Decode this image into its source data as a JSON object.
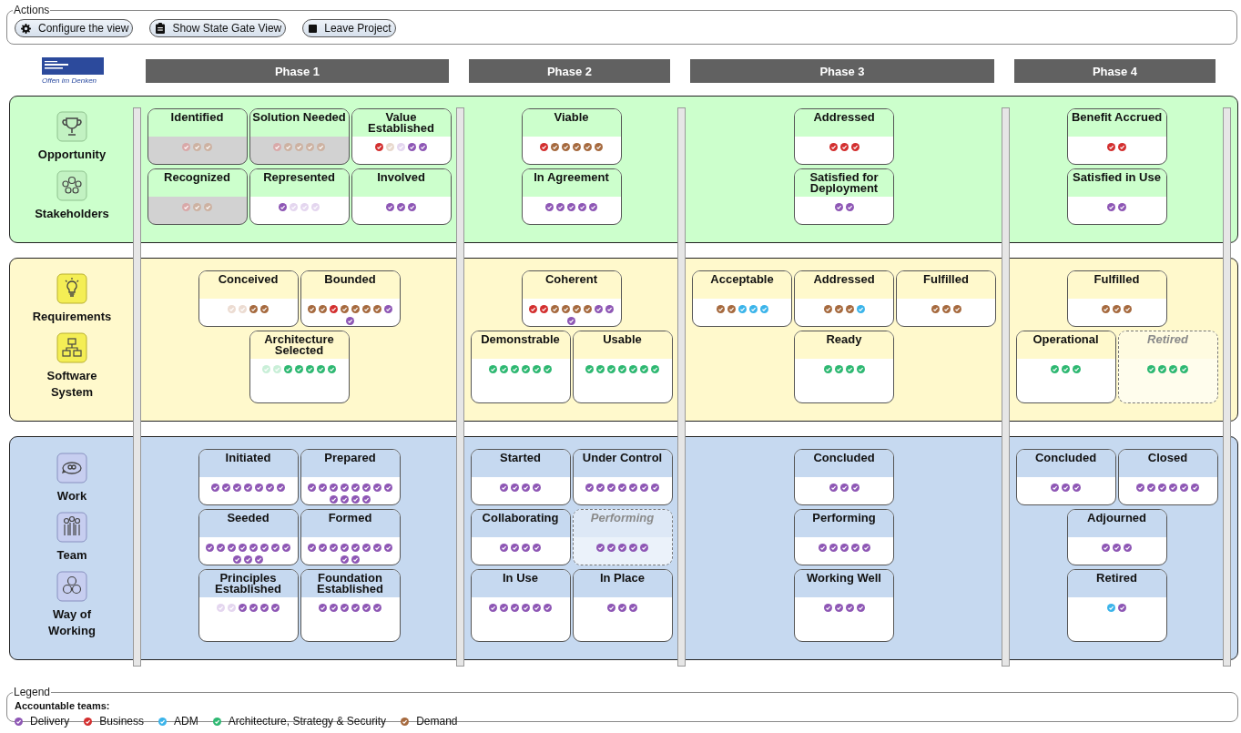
{
  "actions": {
    "title": "Actions",
    "buttons": [
      {
        "label": "Configure the view"
      },
      {
        "label": "Show State Gate View"
      },
      {
        "label": "Leave Project"
      }
    ]
  },
  "logo": {
    "tagline": "Offen im Denken"
  },
  "phases": [
    "Phase 1",
    "Phase 2",
    "Phase 3",
    "Phase 4"
  ],
  "bands": [
    {
      "color": "#ccffcc",
      "alphas": [
        "Opportunity",
        "Stakeholders"
      ],
      "cells": [
        {
          "rows": [
            [
              {
                "title": "Identified",
                "kind": "unreached",
                "checks": [
                  {
                    "color": "#d9a9a9"
                  },
                  {
                    "color": "#cdb2a2"
                  },
                  {
                    "color": "#cdb2a2"
                  }
                ]
              },
              {
                "title": "Solution Needed",
                "kind": "unreached",
                "checks": [
                  {
                    "color": "#d9a9a9"
                  },
                  {
                    "color": "#cdb2a2"
                  },
                  {
                    "color": "#cdb2a2"
                  },
                  {
                    "color": "#cdb2a2"
                  },
                  {
                    "color": "#cdb2a2"
                  }
                ]
              },
              {
                "title": "Value Established",
                "kind": "normal",
                "checks": [
                  {
                    "color": "#d32f2f"
                  },
                  {
                    "color": "#e8d8cc"
                  },
                  {
                    "color": "#e4d6ef"
                  },
                  {
                    "color": "#8e57b5"
                  },
                  {
                    "color": "#8e57b5"
                  }
                ]
              }
            ],
            [
              {
                "title": "Recognized",
                "kind": "unreached",
                "checks": [
                  {
                    "color": "#d9a9a9"
                  },
                  {
                    "color": "#cdb2a2"
                  },
                  {
                    "color": "#cdb2a2"
                  }
                ]
              },
              {
                "title": "Represented",
                "kind": "normal",
                "checks": [
                  {
                    "color": "#8e57b5"
                  },
                  {
                    "color": "#e4d6ef"
                  },
                  {
                    "color": "#e4d6ef"
                  },
                  {
                    "color": "#e4d6ef"
                  }
                ]
              },
              {
                "title": "Involved",
                "kind": "normal",
                "checks": [
                  {
                    "color": "#8e57b5"
                  },
                  {
                    "color": "#8e57b5"
                  },
                  {
                    "color": "#8e57b5"
                  }
                ]
              }
            ]
          ]
        },
        {
          "rows": [
            [
              {
                "title": "Viable",
                "kind": "normal",
                "checks": [
                  {
                    "color": "#d32f2f"
                  },
                  {
                    "color": "#a66a3f"
                  },
                  {
                    "color": "#a66a3f"
                  },
                  {
                    "color": "#a66a3f"
                  },
                  {
                    "color": "#a66a3f"
                  },
                  {
                    "color": "#a66a3f"
                  }
                ]
              }
            ],
            [
              {
                "title": "In Agreement",
                "kind": "normal",
                "checks": [
                  {
                    "color": "#8e57b5"
                  },
                  {
                    "color": "#8e57b5"
                  },
                  {
                    "color": "#8e57b5"
                  },
                  {
                    "color": "#8e57b5"
                  },
                  {
                    "color": "#8e57b5"
                  }
                ]
              }
            ]
          ]
        },
        {
          "rows": [
            [
              {
                "title": "Addressed",
                "kind": "normal",
                "checks": [
                  {
                    "color": "#d32f2f"
                  },
                  {
                    "color": "#d32f2f"
                  },
                  {
                    "color": "#d32f2f"
                  }
                ]
              }
            ],
            [
              {
                "title": "Satisfied for Deployment",
                "kind": "normal",
                "checks": [
                  {
                    "color": "#8e57b5"
                  },
                  {
                    "color": "#8e57b5"
                  }
                ]
              }
            ]
          ]
        },
        {
          "rows": [
            [
              {
                "title": "Benefit Accrued",
                "kind": "normal",
                "checks": [
                  {
                    "color": "#d32f2f"
                  },
                  {
                    "color": "#d32f2f"
                  }
                ]
              }
            ],
            [
              {
                "title": "Satisfied in Use",
                "kind": "normal",
                "checks": [
                  {
                    "color": "#8e57b5"
                  },
                  {
                    "color": "#8e57b5"
                  }
                ]
              }
            ]
          ]
        }
      ]
    },
    {
      "color": "#fff9cc",
      "alphas": [
        "Requirements",
        "Software System"
      ],
      "cells": [
        {
          "rows": [
            [
              {
                "title": "Conceived",
                "kind": "normal",
                "checks": [
                  {
                    "color": "#ecdcd2"
                  },
                  {
                    "color": "#ecdcd2"
                  },
                  {
                    "color": "#a66a3f"
                  },
                  {
                    "color": "#a66a3f"
                  }
                ]
              },
              {
                "title": "Bounded",
                "kind": "normal",
                "checks": [
                  {
                    "color": "#a66a3f"
                  },
                  {
                    "color": "#a66a3f"
                  },
                  {
                    "color": "#d32f2f"
                  },
                  {
                    "color": "#a66a3f"
                  },
                  {
                    "color": "#a66a3f"
                  },
                  {
                    "color": "#a66a3f"
                  },
                  {
                    "color": "#a66a3f"
                  },
                  {
                    "color": "#8e57b5"
                  },
                  {
                    "color": "#8e57b5"
                  }
                ]
              }
            ],
            [
              {
                "title": "Architecture Selected",
                "kind": "normal",
                "checks": [
                  {
                    "color": "#c9efd8"
                  },
                  {
                    "color": "#c9efd8"
                  },
                  {
                    "color": "#2eb872"
                  },
                  {
                    "color": "#2eb872"
                  },
                  {
                    "color": "#2eb872"
                  },
                  {
                    "color": "#2eb872"
                  },
                  {
                    "color": "#2eb872"
                  }
                ]
              }
            ]
          ]
        },
        {
          "rows": [
            [
              {
                "title": "Coherent",
                "kind": "normal",
                "checks": [
                  {
                    "color": "#d32f2f"
                  },
                  {
                    "color": "#d32f2f"
                  },
                  {
                    "color": "#a66a3f"
                  },
                  {
                    "color": "#a66a3f"
                  },
                  {
                    "color": "#a66a3f"
                  },
                  {
                    "color": "#a66a3f"
                  },
                  {
                    "color": "#8e57b5"
                  },
                  {
                    "color": "#8e57b5"
                  },
                  {
                    "color": "#8e57b5"
                  }
                ]
              }
            ],
            [
              {
                "title": "Demonstrable",
                "kind": "normal",
                "checks": [
                  {
                    "color": "#2eb872"
                  },
                  {
                    "color": "#2eb872"
                  },
                  {
                    "color": "#2eb872"
                  },
                  {
                    "color": "#2eb872"
                  },
                  {
                    "color": "#2eb872"
                  },
                  {
                    "color": "#2eb872"
                  }
                ]
              },
              {
                "title": "Usable",
                "kind": "normal",
                "checks": [
                  {
                    "color": "#2eb872"
                  },
                  {
                    "color": "#2eb872"
                  },
                  {
                    "color": "#2eb872"
                  },
                  {
                    "color": "#2eb872"
                  },
                  {
                    "color": "#2eb872"
                  },
                  {
                    "color": "#2eb872"
                  },
                  {
                    "color": "#2eb872"
                  }
                ]
              }
            ]
          ]
        },
        {
          "rows": [
            [
              {
                "title": "Acceptable",
                "kind": "normal",
                "checks": [
                  {
                    "color": "#a66a3f"
                  },
                  {
                    "color": "#a66a3f"
                  },
                  {
                    "color": "#3bb4ea"
                  },
                  {
                    "color": "#3bb4ea"
                  },
                  {
                    "color": "#3bb4ea"
                  }
                ]
              },
              {
                "title": "Addressed",
                "kind": "normal",
                "checks": [
                  {
                    "color": "#a66a3f"
                  },
                  {
                    "color": "#a66a3f"
                  },
                  {
                    "color": "#a66a3f"
                  },
                  {
                    "color": "#3bb4ea"
                  }
                ]
              },
              {
                "title": "Fulfilled",
                "kind": "normal",
                "checks": [
                  {
                    "color": "#a66a3f"
                  },
                  {
                    "color": "#a66a3f"
                  },
                  {
                    "color": "#a66a3f"
                  }
                ]
              }
            ],
            [
              "",
              {
                "title": "Ready",
                "kind": "normal",
                "checks": [
                  {
                    "color": "#2eb872"
                  },
                  {
                    "color": "#2eb872"
                  },
                  {
                    "color": "#2eb872"
                  },
                  {
                    "color": "#2eb872"
                  }
                ]
              },
              ""
            ]
          ]
        },
        {
          "rows": [
            [
              {
                "title": "Fulfilled",
                "kind": "normal",
                "checks": [
                  {
                    "color": "#a66a3f"
                  },
                  {
                    "color": "#a66a3f"
                  },
                  {
                    "color": "#a66a3f"
                  }
                ]
              }
            ],
            [
              {
                "title": "Operational",
                "kind": "normal",
                "checks": [
                  {
                    "color": "#2eb872"
                  },
                  {
                    "color": "#2eb872"
                  },
                  {
                    "color": "#2eb872"
                  }
                ]
              },
              {
                "title": "Retired",
                "kind": "dashed",
                "checks": [
                  {
                    "color": "#2eb872"
                  },
                  {
                    "color": "#2eb872"
                  },
                  {
                    "color": "#2eb872"
                  },
                  {
                    "color": "#2eb872"
                  }
                ]
              }
            ]
          ]
        }
      ]
    },
    {
      "color": "#c6d9f0",
      "alphas": [
        "Work",
        "Team",
        "Way of Working"
      ],
      "cells": [
        {
          "rows": [
            [
              {
                "title": "Initiated",
                "kind": "normal",
                "checks": [
                  {
                    "color": "#8e57b5"
                  },
                  {
                    "color": "#8e57b5"
                  },
                  {
                    "color": "#8e57b5"
                  },
                  {
                    "color": "#8e57b5"
                  },
                  {
                    "color": "#8e57b5"
                  },
                  {
                    "color": "#8e57b5"
                  },
                  {
                    "color": "#8e57b5"
                  }
                ]
              },
              {
                "title": "Prepared",
                "kind": "normal",
                "checks": [
                  {
                    "color": "#8e57b5"
                  },
                  {
                    "color": "#8e57b5"
                  },
                  {
                    "color": "#8e57b5"
                  },
                  {
                    "color": "#8e57b5"
                  },
                  {
                    "color": "#8e57b5"
                  },
                  {
                    "color": "#8e57b5"
                  },
                  {
                    "color": "#8e57b5"
                  },
                  {
                    "color": "#8e57b5"
                  },
                  {
                    "color": "#8e57b5"
                  },
                  {
                    "color": "#8e57b5"
                  },
                  {
                    "color": "#8e57b5"
                  },
                  {
                    "color": "#8e57b5"
                  }
                ]
              }
            ],
            [
              {
                "title": "Seeded",
                "kind": "normal",
                "checks": [
                  {
                    "color": "#8e57b5"
                  },
                  {
                    "color": "#8e57b5"
                  },
                  {
                    "color": "#8e57b5"
                  },
                  {
                    "color": "#8e57b5"
                  },
                  {
                    "color": "#8e57b5"
                  },
                  {
                    "color": "#8e57b5"
                  },
                  {
                    "color": "#8e57b5"
                  },
                  {
                    "color": "#8e57b5"
                  },
                  {
                    "color": "#8e57b5"
                  },
                  {
                    "color": "#8e57b5"
                  },
                  {
                    "color": "#8e57b5"
                  }
                ]
              },
              {
                "title": "Formed",
                "kind": "normal",
                "checks": [
                  {
                    "color": "#8e57b5"
                  },
                  {
                    "color": "#8e57b5"
                  },
                  {
                    "color": "#8e57b5"
                  },
                  {
                    "color": "#8e57b5"
                  },
                  {
                    "color": "#8e57b5"
                  },
                  {
                    "color": "#8e57b5"
                  },
                  {
                    "color": "#8e57b5"
                  },
                  {
                    "color": "#8e57b5"
                  },
                  {
                    "color": "#8e57b5"
                  },
                  {
                    "color": "#8e57b5"
                  }
                ]
              }
            ],
            [
              {
                "title": "Principles Established",
                "kind": "normal",
                "checks": [
                  {
                    "color": "#e4d6ef"
                  },
                  {
                    "color": "#e4d6ef"
                  },
                  {
                    "color": "#8e57b5"
                  },
                  {
                    "color": "#8e57b5"
                  },
                  {
                    "color": "#8e57b5"
                  },
                  {
                    "color": "#8e57b5"
                  }
                ]
              },
              {
                "title": "Foundation Established",
                "kind": "normal",
                "checks": [
                  {
                    "color": "#8e57b5"
                  },
                  {
                    "color": "#8e57b5"
                  },
                  {
                    "color": "#8e57b5"
                  },
                  {
                    "color": "#8e57b5"
                  },
                  {
                    "color": "#8e57b5"
                  },
                  {
                    "color": "#8e57b5"
                  }
                ]
              }
            ]
          ]
        },
        {
          "rows": [
            [
              {
                "title": "Started",
                "kind": "normal",
                "checks": [
                  {
                    "color": "#8e57b5"
                  },
                  {
                    "color": "#8e57b5"
                  },
                  {
                    "color": "#8e57b5"
                  },
                  {
                    "color": "#8e57b5"
                  }
                ]
              },
              {
                "title": "Under Control",
                "kind": "normal",
                "checks": [
                  {
                    "color": "#8e57b5"
                  },
                  {
                    "color": "#8e57b5"
                  },
                  {
                    "color": "#8e57b5"
                  },
                  {
                    "color": "#8e57b5"
                  },
                  {
                    "color": "#8e57b5"
                  },
                  {
                    "color": "#8e57b5"
                  },
                  {
                    "color": "#8e57b5"
                  }
                ]
              }
            ],
            [
              {
                "title": "Collaborating",
                "kind": "normal",
                "checks": [
                  {
                    "color": "#8e57b5"
                  },
                  {
                    "color": "#8e57b5"
                  },
                  {
                    "color": "#8e57b5"
                  },
                  {
                    "color": "#8e57b5"
                  }
                ]
              },
              {
                "title": "Performing",
                "kind": "dashed",
                "checks": [
                  {
                    "color": "#8e57b5"
                  },
                  {
                    "color": "#8e57b5"
                  },
                  {
                    "color": "#8e57b5"
                  },
                  {
                    "color": "#8e57b5"
                  },
                  {
                    "color": "#8e57b5"
                  }
                ]
              }
            ],
            [
              {
                "title": "In Use",
                "kind": "normal",
                "checks": [
                  {
                    "color": "#8e57b5"
                  },
                  {
                    "color": "#8e57b5"
                  },
                  {
                    "color": "#8e57b5"
                  },
                  {
                    "color": "#8e57b5"
                  },
                  {
                    "color": "#8e57b5"
                  },
                  {
                    "color": "#8e57b5"
                  }
                ]
              },
              {
                "title": "In Place",
                "kind": "normal",
                "checks": [
                  {
                    "color": "#8e57b5"
                  },
                  {
                    "color": "#8e57b5"
                  },
                  {
                    "color": "#8e57b5"
                  }
                ]
              }
            ]
          ]
        },
        {
          "rows": [
            [
              {
                "title": "Concluded",
                "kind": "normal",
                "checks": [
                  {
                    "color": "#8e57b5"
                  },
                  {
                    "color": "#8e57b5"
                  },
                  {
                    "color": "#8e57b5"
                  }
                ]
              }
            ],
            [
              {
                "title": "Performing",
                "kind": "normal",
                "checks": [
                  {
                    "color": "#8e57b5"
                  },
                  {
                    "color": "#8e57b5"
                  },
                  {
                    "color": "#8e57b5"
                  },
                  {
                    "color": "#8e57b5"
                  },
                  {
                    "color": "#8e57b5"
                  }
                ]
              }
            ],
            [
              {
                "title": "Working Well",
                "kind": "normal",
                "checks": [
                  {
                    "color": "#8e57b5"
                  },
                  {
                    "color": "#8e57b5"
                  },
                  {
                    "color": "#8e57b5"
                  },
                  {
                    "color": "#8e57b5"
                  }
                ]
              }
            ]
          ]
        },
        {
          "rows": [
            [
              {
                "title": "Concluded",
                "kind": "normal",
                "checks": [
                  {
                    "color": "#8e57b5"
                  },
                  {
                    "color": "#8e57b5"
                  },
                  {
                    "color": "#8e57b5"
                  }
                ]
              },
              {
                "title": "Closed",
                "kind": "normal",
                "checks": [
                  {
                    "color": "#8e57b5"
                  },
                  {
                    "color": "#8e57b5"
                  },
                  {
                    "color": "#8e57b5"
                  },
                  {
                    "color": "#8e57b5"
                  },
                  {
                    "color": "#8e57b5"
                  },
                  {
                    "color": "#8e57b5"
                  }
                ]
              }
            ],
            [
              {
                "title": "Adjourned",
                "kind": "normal",
                "checks": [
                  {
                    "color": "#8e57b5"
                  },
                  {
                    "color": "#8e57b5"
                  },
                  {
                    "color": "#8e57b5"
                  }
                ]
              }
            ],
            [
              {
                "title": "Retired",
                "kind": "normal",
                "checks": [
                  {
                    "color": "#3bb4ea"
                  },
                  {
                    "color": "#8e57b5"
                  }
                ]
              }
            ]
          ]
        }
      ]
    }
  ],
  "legend": {
    "title": "Legend",
    "heading": "Accountable teams:",
    "teams": [
      {
        "name": "Delivery",
        "color": "#8e57b5"
      },
      {
        "name": "Business",
        "color": "#d32f2f"
      },
      {
        "name": "ADM",
        "color": "#3bb4ea"
      },
      {
        "name": "Architecture, Strategy & Security",
        "color": "#2eb872"
      },
      {
        "name": "Demand",
        "color": "#a66a3f"
      }
    ]
  }
}
